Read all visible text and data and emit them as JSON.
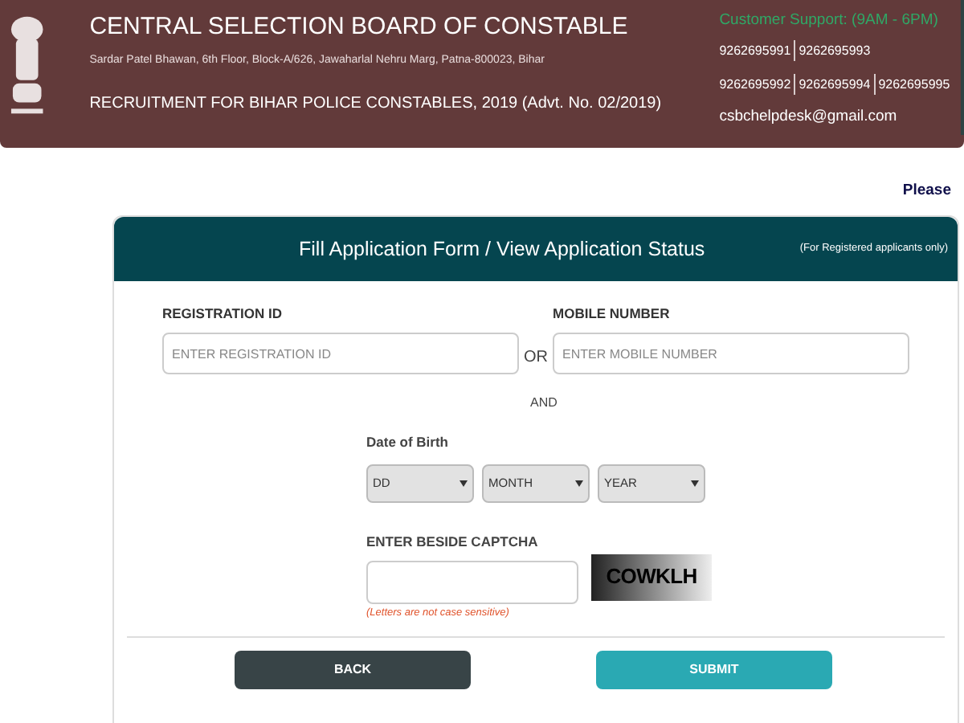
{
  "header": {
    "title": "CENTRAL SELECTION BOARD OF CONSTABLE",
    "address": "Sardar Patel Bhawan, 6th Floor, Block-A/626, Jawaharlal Nehru Marg, Patna-800023, Bihar",
    "recruitment": "RECRUITMENT FOR BIHAR POLICE CONSTABLES, 2019 (Advt. No. 02/2019)",
    "support_title": "Customer Support: (9AM - 6PM)",
    "phone_rows": [
      [
        "9262695991",
        "9262695993"
      ],
      [
        "9262695992",
        "9262695994",
        "9262695995"
      ]
    ],
    "email": "csbchelpdesk@gmail.com"
  },
  "notice": "Please",
  "form": {
    "title": "Fill Application Form / View Application Status",
    "subtitle": "(For Registered applicants only)",
    "registration": {
      "label": "REGISTRATION ID",
      "placeholder": "ENTER REGISTRATION ID"
    },
    "or": "OR",
    "mobile": {
      "label": "MOBILE NUMBER",
      "placeholder": "ENTER MOBILE NUMBER"
    },
    "and": "AND",
    "dob_label": "Date of Birth",
    "dob_selects": [
      "DD",
      "MONTH",
      "YEAR"
    ],
    "captcha_label": "ENTER BESIDE CAPTCHA",
    "captcha_text": "COWKLH",
    "captcha_hint": "(Letters are not case sensitive)",
    "buttons": [
      {
        "label": "BACK",
        "kind": "back"
      },
      {
        "label": "SUBMIT",
        "kind": "submit"
      }
    ]
  }
}
